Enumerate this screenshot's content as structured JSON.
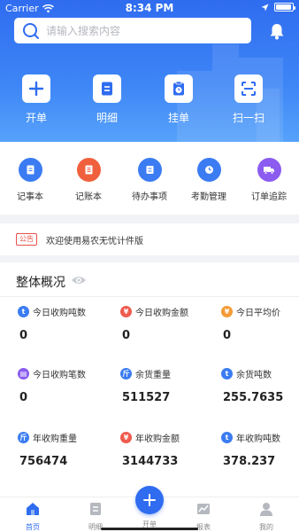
{
  "status_bar": {
    "carrier": "Carrier",
    "time": "8:34 PM",
    "battery_level": 0.95
  },
  "search": {
    "placeholder": "请输入搜索内容",
    "value": ""
  },
  "quick_actions": [
    {
      "label": "开单",
      "icon": "plus-icon"
    },
    {
      "label": "明细",
      "icon": "document-icon"
    },
    {
      "label": "挂单",
      "icon": "clipboard-clock-icon"
    },
    {
      "label": "扫一扫",
      "icon": "scan-icon"
    }
  ],
  "features": [
    {
      "label": "记事本",
      "icon": "notebook-icon",
      "color": "#3b7cf2"
    },
    {
      "label": "记账本",
      "icon": "ledger-icon",
      "color": "#f0603d"
    },
    {
      "label": "待办事项",
      "icon": "todo-icon",
      "color": "#3b7cf2"
    },
    {
      "label": "考勤管理",
      "icon": "clock-icon",
      "color": "#3b7cf2"
    },
    {
      "label": "订单追踪",
      "icon": "truck-icon",
      "color": "#8c5cf0"
    }
  ],
  "notice": {
    "badge": "公告",
    "text": "欢迎使用易农无忧计件版"
  },
  "overview": {
    "title": "整体概况",
    "stats": [
      {
        "label": "今日收购吨数",
        "value": "0",
        "badge": "t",
        "color": "#3b7cf2"
      },
      {
        "label": "今日收购金额",
        "value": "0",
        "badge": "¥",
        "color": "#ef5a4e"
      },
      {
        "label": "今日平均价",
        "value": "0",
        "badge": "¥",
        "color": "#f59a35"
      },
      {
        "label": "今日收购笔数",
        "value": "0",
        "badge": "▤",
        "color": "#8a5cf0"
      },
      {
        "label": "余货重量",
        "value": "511527",
        "badge": "斤",
        "color": "#3b7cf2"
      },
      {
        "label": "余货吨数",
        "value": "255.7635",
        "badge": "t",
        "color": "#3b7cf2"
      },
      {
        "label": "年收购重量",
        "value": "756474",
        "badge": "斤",
        "color": "#3b7cf2"
      },
      {
        "label": "年收购金额",
        "value": "3144733",
        "badge": "¥",
        "color": "#ef5a4e"
      },
      {
        "label": "年收购吨数",
        "value": "378.237",
        "badge": "t",
        "color": "#3b7cf2"
      }
    ]
  },
  "tabs": [
    {
      "label": "首页",
      "icon": "home-icon",
      "active": true
    },
    {
      "label": "明细",
      "icon": "list-icon",
      "active": false
    },
    {
      "label": "开单",
      "icon": "plus-icon",
      "active": false
    },
    {
      "label": "报表",
      "icon": "chart-icon",
      "active": false
    },
    {
      "label": "我的",
      "icon": "user-icon",
      "active": false
    }
  ],
  "colors": {
    "primary": "#2f6cf0",
    "notice": "#e8504a"
  }
}
